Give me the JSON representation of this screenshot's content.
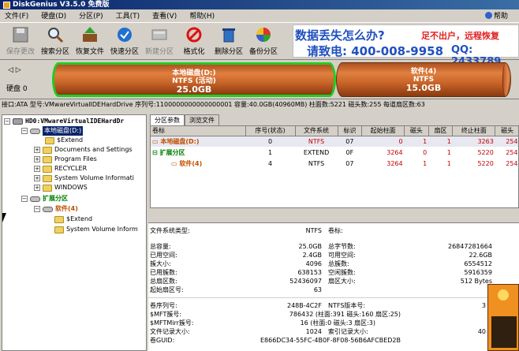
{
  "window": {
    "title": "DiskGenius V3.5.0 免费版"
  },
  "menu": {
    "items": [
      "文件(F)",
      "硬盘(D)",
      "分区(P)",
      "工具(T)",
      "查看(V)",
      "帮助(H)"
    ],
    "help_label": "帮助"
  },
  "toolbar": {
    "buttons": [
      {
        "label": "保存更改",
        "icon": "save-icon",
        "enabled": false
      },
      {
        "label": "搜索分区",
        "icon": "search-icon",
        "enabled": true
      },
      {
        "label": "恢复文件",
        "icon": "recover-files-icon",
        "enabled": true
      },
      {
        "label": "快速分区",
        "icon": "quick-partition-icon",
        "enabled": true
      },
      {
        "label": "新建分区",
        "icon": "new-partition-icon",
        "enabled": false
      },
      {
        "label": "格式化",
        "icon": "format-icon",
        "enabled": true
      },
      {
        "label": "删除分区",
        "icon": "delete-partition-icon",
        "enabled": true
      },
      {
        "label": "备份分区",
        "icon": "backup-partition-icon",
        "enabled": true
      }
    ]
  },
  "ad": {
    "line1": "数据丢失怎么办?",
    "line1b": "足不出户，远程恢复",
    "line2": "请致电: 400-008-9958",
    "line2b": "QQ: 2433789"
  },
  "disk_map": {
    "disk_label": "硬盘 0",
    "partitions": [
      {
        "name": "本地磁盘(D:)",
        "fs": "NTFS (活动)",
        "size": "25.0GB",
        "selected": true
      },
      {
        "name": "软件(4)",
        "fs": "NTFS",
        "size": "15.0GB",
        "selected": false
      }
    ],
    "colors": {
      "partition": "#c86428",
      "selected_border": "#22cc22"
    }
  },
  "disk_info": "接口:ATA  型号:VMwareVirtualIDEHardDrive  序列号:1100000000000000001  容量:40.0GB(40960MB)  柱面数:5221  磁头数:255  每道扇区数:63",
  "tree": {
    "items": [
      {
        "label": "HD0:VMwareVirtualIDEHardDr",
        "type": "disk",
        "expander": "−"
      },
      {
        "label": "本地磁盘(D:)",
        "type": "partition-selected",
        "expander": "−"
      },
      {
        "label": "$Extend",
        "type": "folder",
        "expander": ""
      },
      {
        "label": "Documents and Settings",
        "type": "folder",
        "expander": "+"
      },
      {
        "label": "Program Files",
        "type": "folder",
        "expander": "+"
      },
      {
        "label": "RECYCLER",
        "type": "folder",
        "expander": "+"
      },
      {
        "label": "System Volume Informati",
        "type": "folder",
        "expander": "+"
      },
      {
        "label": "WINDOWS",
        "type": "folder",
        "expander": "+"
      },
      {
        "label": "扩展分区",
        "type": "extended",
        "expander": "−"
      },
      {
        "label": "软件(4)",
        "type": "partition",
        "expander": "−"
      },
      {
        "label": "$Extend",
        "type": "folder",
        "expander": ""
      },
      {
        "label": "System Volume Inform",
        "type": "folder",
        "expander": ""
      }
    ]
  },
  "tabs": [
    "分区参数",
    "浏览文件"
  ],
  "partition_table": {
    "headers": [
      "卷标",
      "序号(状态)",
      "文件系统",
      "标识",
      "起始柱面",
      "磁头",
      "扇区",
      "终止柱面",
      "磁头"
    ],
    "rows": [
      [
        "本地磁盘(D:)",
        "0",
        "NTFS",
        "07",
        "0",
        "1",
        "1",
        "3263",
        "254"
      ],
      [
        "扩展分区",
        "1",
        "EXTEND",
        "0F",
        "3264",
        "0",
        "1",
        "5220",
        "254"
      ],
      [
        "软件(4)",
        "4",
        "NTFS",
        "07",
        "3264",
        "1",
        "1",
        "5220",
        "254"
      ]
    ]
  },
  "details": {
    "fs_type_label": "文件系统类型:",
    "fs_type": "NTFS",
    "vol_label_label": "卷标:",
    "total_capacity_label": "总容量:",
    "total_capacity": "25.0GB",
    "total_bytes_label": "总字节数:",
    "total_bytes": "26847281664",
    "used_label": "已用空间:",
    "used": "2.4GB",
    "free_label": "可用空间:",
    "free": "22.6GB",
    "cluster_size_label": "簇大小:",
    "cluster_size": "4096",
    "total_clusters_label": "总簇数:",
    "total_clusters": "6554512",
    "used_clusters_label": "已用簇数:",
    "used_clusters": "638153",
    "free_clusters_label": "空闲簇数:",
    "free_clusters": "5916359",
    "total_sectors_label": "总扇区数:",
    "total_sectors": "52436097",
    "sector_size_label": "扇区大小:",
    "sector_size": "512 Bytes",
    "start_sector_label": "起始扇区号:",
    "start_sector": "63",
    "serial_label": "卷序列号:",
    "serial": "248B-4C2F",
    "ntfs_ver_label": "NTFS版本号:",
    "ntfs_ver": "3",
    "mft_label": "$MFT簇号:",
    "mft": "786432 (柱面:391 磁头:160 扇区:25)",
    "mftmirr_label": "$MFTMirr簇号:",
    "mftmirr": "16 (柱面:0 磁头:3 扇区:3)",
    "record_size_label": "文件记录大小:",
    "record_size": "1024",
    "index_size_label": "索引记录大小:",
    "index_size": "40",
    "guid_label": "卷GUID:",
    "guid": "E866DC34-55FC-4B0F-8F08-56B6AFCBED2B"
  }
}
